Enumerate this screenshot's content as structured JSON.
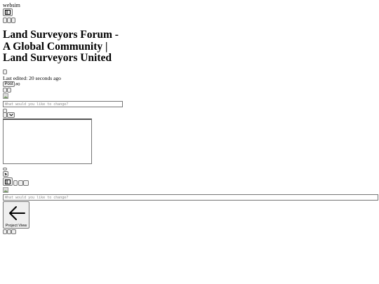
{
  "app": {
    "name": "websim"
  },
  "page": {
    "title": "Land Surveyors Forum - A Global Community | Land Surveyors United",
    "last_edited": "Last edited: 20 seconds ago",
    "post_button": "Post",
    "version_tag": "#0"
  },
  "editor": {
    "placeholder": "What would you like to change?"
  },
  "bottom_editor": {
    "placeholder": "What would you like to change?"
  },
  "project_view": {
    "label": "Project View",
    "icon": "arrow-left-icon"
  }
}
